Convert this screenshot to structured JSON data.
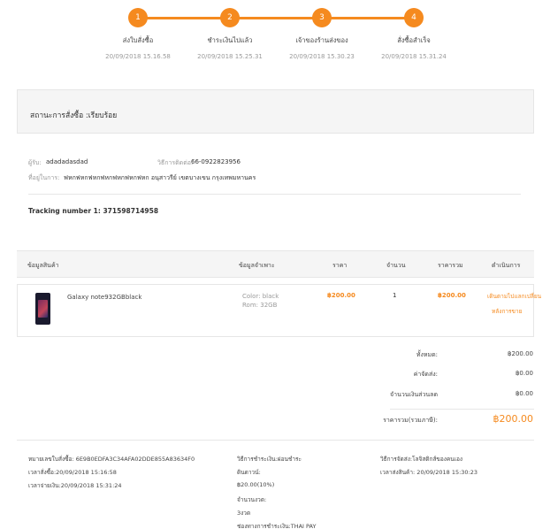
{
  "steps": [
    {
      "num": "1",
      "label": "ส่งใบสั่งซื้อ",
      "date": "20/09/2018 15.16.58"
    },
    {
      "num": "2",
      "label": "ชำระเงินไปแล้ว",
      "date": "20/09/2018 15.25.31"
    },
    {
      "num": "3",
      "label": "เจ้าของร้านส่งของ",
      "date": "20/09/2018 15.30.23"
    },
    {
      "num": "4",
      "label": "สั่งซื้อสำเร็จ",
      "date": "20/09/2018 15.31.24"
    }
  ],
  "status": {
    "text": "สถานะการสั่งซื้อ :เรียบร้อย"
  },
  "buyer": {
    "name_label": "ผู้รับ:",
    "name": "adadadasdad",
    "contact_label": "วิธีการติดต่อ:",
    "phone": "66-0922823956",
    "address_label": "ที่อยู่ในการ:",
    "address": "ฟหกฟหกฟหกฟหกฟหกฟหกฟหก อนุสาวรีย์ เขตบางเขน กรุงเทพมหานคร"
  },
  "tracking": {
    "text": "Tracking number 1: 371598714958"
  },
  "table": {
    "headers": {
      "product": "ข้อมูลสินค้า",
      "specs": "ข้อมูลจำเพาะ",
      "price": "ราคา",
      "qty": "จำนวน",
      "total": "ราคารวม",
      "action": "ดำเนินการ"
    },
    "row": {
      "name": "Galaxy note932GBblack",
      "color": "Color: black",
      "rom": "Rom: 32GB",
      "price": "฿200.00",
      "qty": "1",
      "total": "฿200.00",
      "action_line1": "เดินตามไปแลกเปลี่ยน",
      "action_line2": "หลังการขาย"
    }
  },
  "summary": {
    "subtotal_label": "ทั้งหมด:",
    "subtotal": "฿200.00",
    "shipping_label": "ค่าจัดส่ง:",
    "shipping": "฿0.00",
    "discount_label": "จำนวนเงินส่วนลด",
    "discount": "฿0.00",
    "grand_label": "ราคารวม(รวมภาษี):",
    "grand": "฿200.00"
  },
  "footer": {
    "order_no": "หมายเลขใบสั่งซื้อ:   6E9B0EDFA3C34AFA02DDE855A83634F0",
    "order_time": "เวลาสั่งซื้อ:20/09/2018 15:16:58",
    "pay_time": "เวลาจ่ายเงิน:20/09/2018 15:31:24",
    "pay_method": "วิธีการชำระเงิน:ผ่อนชำระ",
    "installment_label": "ดินดาวน์:",
    "installment": "฿20.00(10%)",
    "period_label": "จำนวนงวด:",
    "period": "3งวด",
    "channel": "ช่องทางการชำระเงิน:THAI PAY",
    "delivery_method": "วิธีการจัดส่ง:โลจิสติกส์ของคนเอง",
    "delivery_time": "เวลาส่งสินค้า:   20/09/2018 15:30:23"
  },
  "colors": {
    "accent": "#f58a1f",
    "panel": "#f5f5f5",
    "border": "#e6e6e6"
  }
}
